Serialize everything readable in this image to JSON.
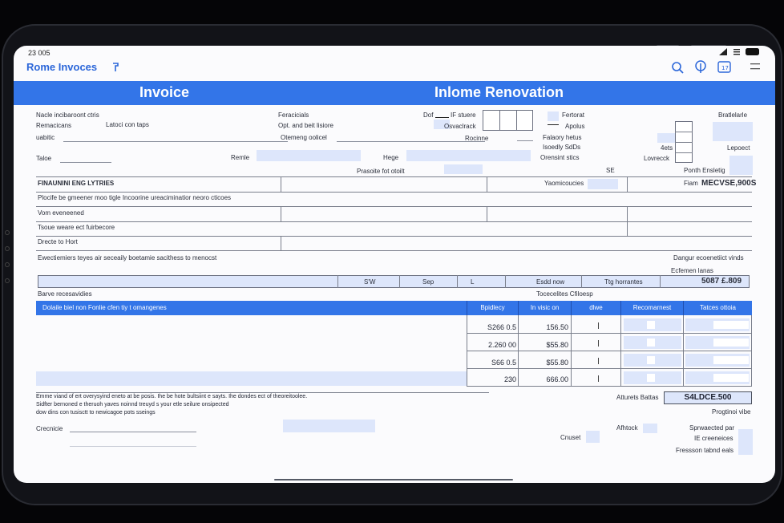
{
  "status": {
    "time": "23 005"
  },
  "app": {
    "title": "Rome Invoces"
  },
  "banner": {
    "left": "Invoice",
    "right": "Inlome Renovation"
  },
  "header": {
    "l1": "Nacle incibaroont ctris",
    "l2a": "Remacicans",
    "l2b": "Latoci con taps",
    "l3": "uabitic",
    "l4": "Taloe",
    "m1": "Feracicials",
    "m2": "Opt. and beit lisiore",
    "m3": "Otemeng oolicel",
    "m4": "Remle",
    "c1": "Dof",
    "c2": "IF stuere",
    "c3": "Osvaclrack",
    "c4": "Rocinne",
    "c5": "Hege",
    "c6": "Prasoite fot otoilt",
    "r1": "Fertorat",
    "r2": "Apolus",
    "r3": "Falaory hetus",
    "r4": "Isoedly SdDs",
    "r5": "Orensint stics",
    "r6": "SE",
    "fr1": "Bratlelarle",
    "fr2": "4ets",
    "fr3": "Lovrecck",
    "fr4": "Lepoect",
    "fr5": "Ponth Ensletig"
  },
  "section1": {
    "title": "FINAUNINI ENG LYTRIES",
    "r1": "Plocife be gmeener moo tigle Incoorine ureaciminatior neoro cticoes",
    "r2": "Vom eveneened",
    "r3": "Tsoue weare ect fuirbecore",
    "r4": "Drecte to Hort",
    "r5": "Ewectiemiers teyes air seceaily boetamie sacithess to menocst",
    "col3": "Yaomicoucies",
    "flat_label": "Fiam",
    "flat_value": "MECVSE,900S",
    "right_note": "Dangur ecoenetiict vinds",
    "right_note2": "Ecfemen lanas"
  },
  "summary": {
    "c1": "S'W",
    "c2": "Sep",
    "c3": "L",
    "c4": "Esdd now",
    "c5": "Ttg horrantes",
    "total": "5087 £.809"
  },
  "items": {
    "above": "Barve recesavidies",
    "subtitle": "Tocecelites Cfiloesp",
    "headers": [
      "Dolaile biel non Fonlie cfen tiy t omangenes",
      "Bpidlecy",
      "In visic on",
      "dlwe",
      "Recomarnest",
      "Tatces ottoia"
    ],
    "rows": [
      {
        "qty": "S266 0.5",
        "price": "156.50"
      },
      {
        "qty": "2.260 00",
        "price": "$55.80"
      },
      {
        "qty": "S66 0.5",
        "price": "$55.80"
      },
      {
        "qty": "230",
        "price": "666.00"
      }
    ]
  },
  "footer": {
    "note1": "Emme viand of ert overysyind eneto at be posis. Ihe be hote bultsiint e sayts. Ihe dondes ect of theoreitoolee.",
    "note2": "Sidfter bernoned e theruoh yaves noinnd treuyd s your etle seilure onsipected",
    "note3": "dow dins con tusisctt to newicagoe pots sseings",
    "sig_label": "Crecnicie",
    "totals_label": "Atturets Battas",
    "totals_value": "S4LDCE.500",
    "printing": "Progtinoi vibe",
    "afblock": "Afhtock",
    "chuset": "Cnuset",
    "sp1": "Sprwaected par",
    "sp2": "IE creeneices",
    "sp3": "Fressson tabnd eals"
  }
}
